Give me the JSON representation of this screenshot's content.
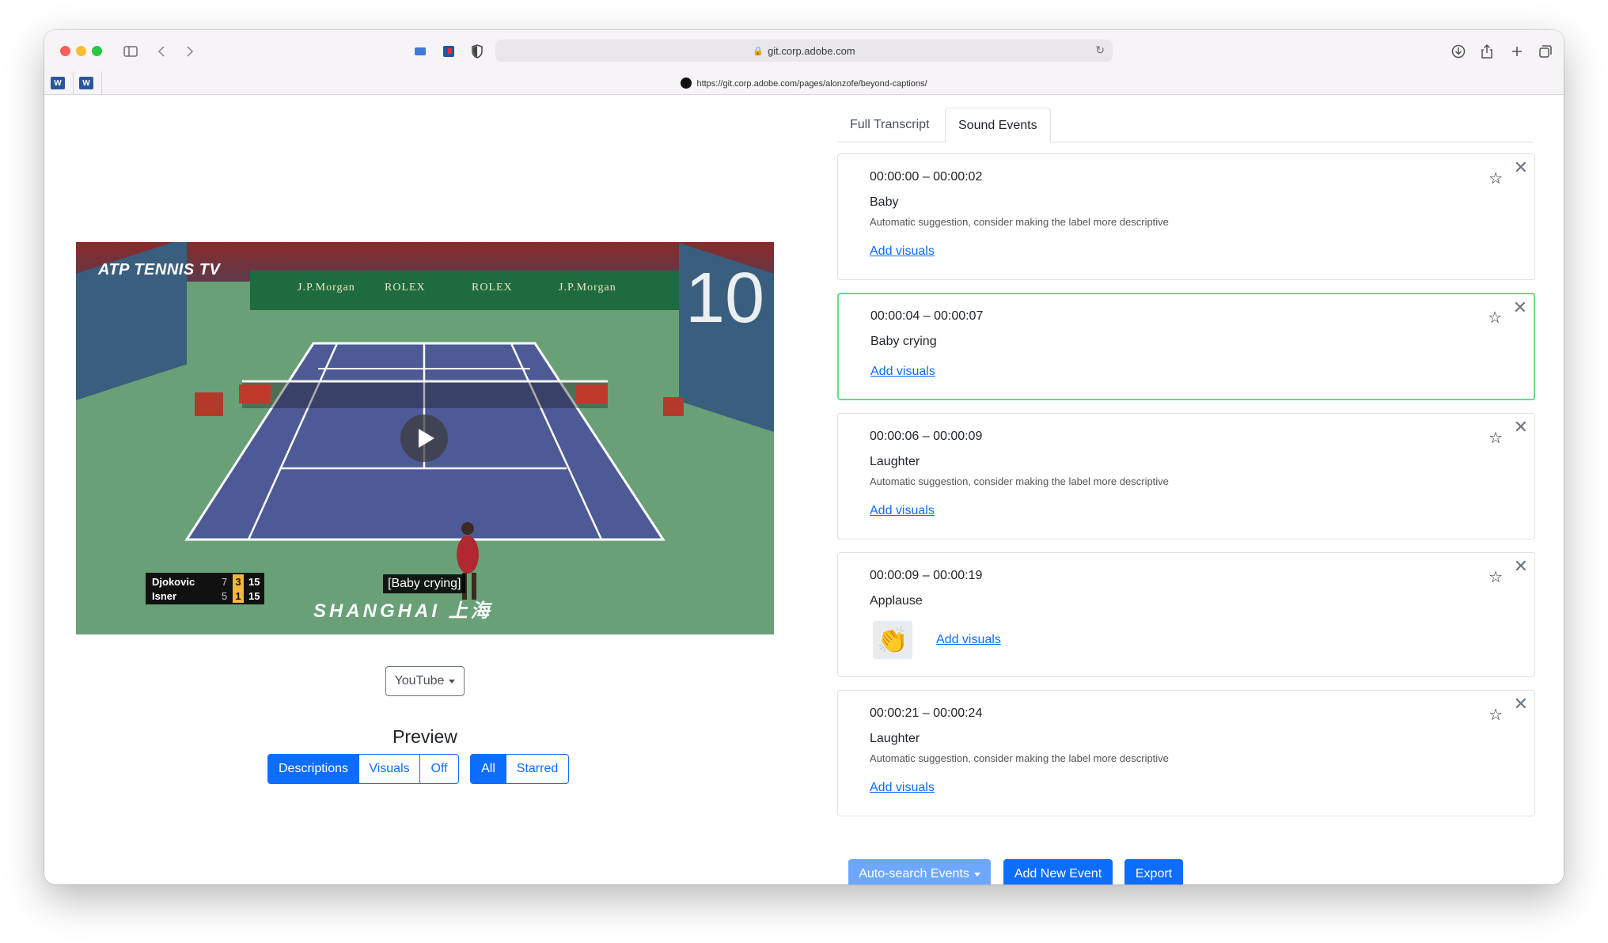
{
  "browser": {
    "address": "git.corp.adobe.com",
    "page_url": "https://git.corp.adobe.com/pages/alonzofe/beyond-captions/",
    "favorites": [
      "W",
      "W"
    ]
  },
  "video": {
    "channel_logo": "ATP TENNIS TV",
    "score_counter": "10",
    "scoreboard": [
      {
        "name": "Djokovic",
        "games": "7",
        "set": "3",
        "points": "15"
      },
      {
        "name": "Isner",
        "games": "5",
        "set": "1",
        "points": "15"
      }
    ],
    "caption": "[Baby crying]",
    "venue": "SHANGHAI 上海",
    "banner_texts": [
      "J.P.Morgan",
      "ROLEX",
      "ROLEX",
      "J.P.Morgan"
    ]
  },
  "source_select": {
    "label": "YouTube"
  },
  "preview": {
    "title": "Preview",
    "mode_buttons": [
      {
        "label": "Descriptions",
        "active": true
      },
      {
        "label": "Visuals",
        "active": false
      },
      {
        "label": "Off",
        "active": false
      }
    ],
    "filter_buttons": [
      {
        "label": "All",
        "active": true
      },
      {
        "label": "Starred",
        "active": false
      }
    ]
  },
  "tabs": [
    {
      "label": "Full Transcript",
      "active": false
    },
    {
      "label": "Sound Events",
      "active": true
    }
  ],
  "events": [
    {
      "time": "00:00:00 – 00:00:02",
      "label": "Baby",
      "note": "Automatic suggestion, consider making the label more descriptive",
      "link": "Add visuals",
      "selected": false,
      "thumb": null
    },
    {
      "time": "00:00:04 – 00:00:07",
      "label": "Baby crying",
      "note": "",
      "link": "Add visuals",
      "selected": true,
      "thumb": null
    },
    {
      "time": "00:00:06 – 00:00:09",
      "label": "Laughter",
      "note": "Automatic suggestion, consider making the label more descriptive",
      "link": "Add visuals",
      "selected": false,
      "thumb": null
    },
    {
      "time": "00:00:09 – 00:00:19",
      "label": "Applause",
      "note": "",
      "link": "Add visuals",
      "selected": false,
      "thumb": "👏"
    },
    {
      "time": "00:00:21 – 00:00:24",
      "label": "Laughter",
      "note": "Automatic suggestion, consider making the label more descriptive",
      "link": "Add visuals",
      "selected": false,
      "thumb": null
    }
  ],
  "actions": {
    "auto_search": "Auto-search Events",
    "add_new": "Add New Event",
    "export": "Export"
  },
  "colors": {
    "primary": "#0d6efd",
    "primary_light": "#6ea8fe",
    "selected_border": "#5ee08a"
  }
}
